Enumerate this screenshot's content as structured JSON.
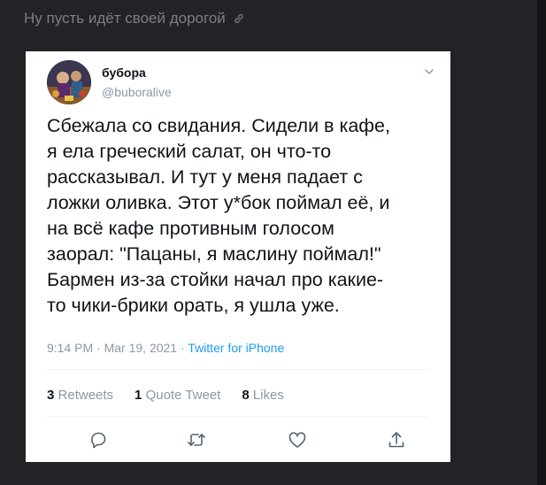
{
  "post": {
    "title": "Ну пусть идёт своей дорогой"
  },
  "tweet": {
    "author_name": "бубора",
    "author_handle": "@buboralive",
    "text_lines": [
      "Сбежала со свидания. Сидели в кафе,",
      "я ела греческий салат, он что-то",
      "рассказывал. И тут у меня падает с",
      "ложки оливка. Этот у*бок поймал её, и",
      "на всё кафе противным голосом",
      "заорал: \"Пацаны, я маслину поймал!\"",
      "Бармен из-за стойки начал про какие-",
      "то чики-брики орать, я ушла уже."
    ],
    "time": "9:14 PM",
    "date": "Mar 19, 2021",
    "dot": "·",
    "source": "Twitter for iPhone",
    "retweets_count": "3",
    "retweets_label": "Retweets",
    "quotes_count": "1",
    "quotes_label": "Quote Tweet",
    "likes_count": "8",
    "likes_label": "Likes"
  },
  "icons": {
    "link": "link-icon",
    "chevron": "chevron-down-icon",
    "reply": "reply-icon",
    "retweet": "retweet-icon",
    "like": "heart-icon",
    "share": "share-icon"
  },
  "colors": {
    "background": "#222326",
    "card": "#ffffff",
    "text": "#0f1419",
    "muted": "#8b98a5",
    "link": "#1d9bf0"
  }
}
